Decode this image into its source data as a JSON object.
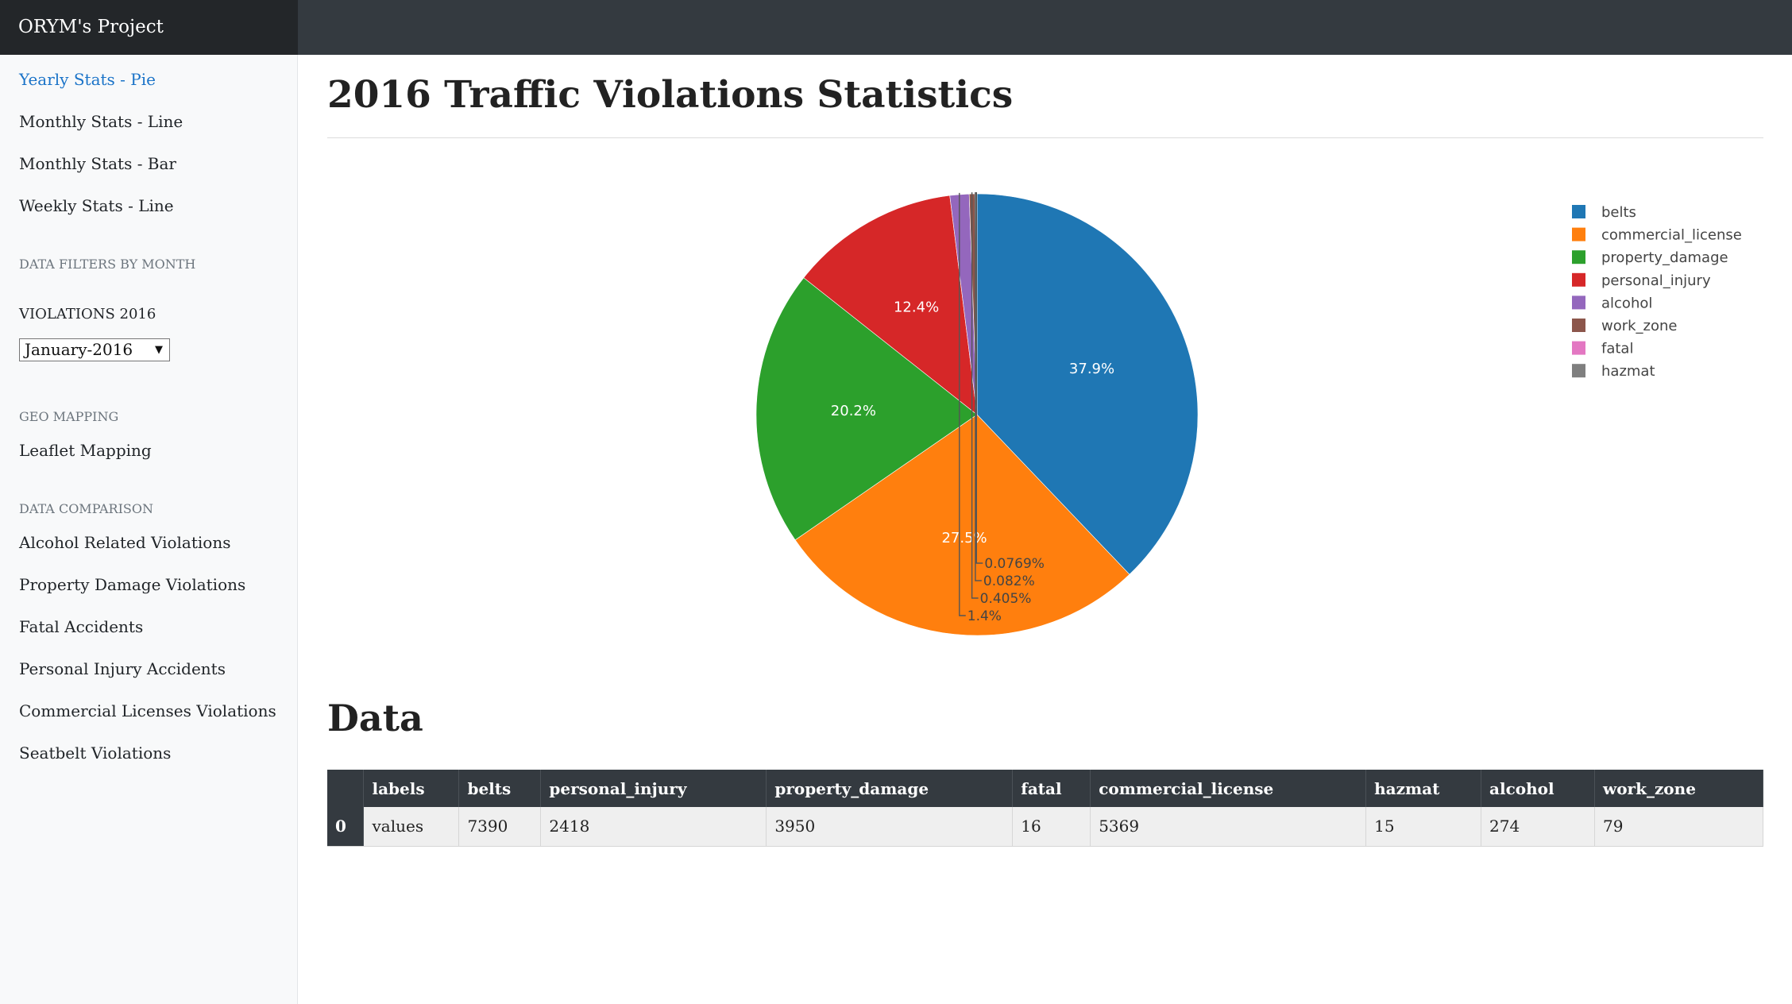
{
  "brand": "ORYM's Project",
  "sidebar": {
    "nav": [
      {
        "label": "Yearly Stats - Pie"
      },
      {
        "label": "Monthly Stats - Line"
      },
      {
        "label": "Monthly Stats - Bar"
      },
      {
        "label": "Weekly Stats - Line"
      }
    ],
    "filters_heading": "DATA FILTERS BY MONTH",
    "violations_label": "VIOLATIONS 2016",
    "month_select": {
      "selected": "January-2016"
    },
    "geo_heading": "GEO MAPPING",
    "geo_links": [
      {
        "label": "Leaflet Mapping"
      }
    ],
    "comparison_heading": "DATA COMPARISON",
    "comparison_links": [
      {
        "label": "Alcohol Related Violations"
      },
      {
        "label": "Property Damage Violations"
      },
      {
        "label": "Fatal Accidents"
      },
      {
        "label": "Personal Injury Accidents"
      },
      {
        "label": "Commercial Licenses Violations"
      },
      {
        "label": "Seatbelt Violations"
      }
    ]
  },
  "main": {
    "title": "2016 Traffic Violations Statistics",
    "data_title": "Data"
  },
  "colors": {
    "belts": "#1f77b4",
    "commercial_license": "#ff7f0e",
    "property_damage": "#2ca02c",
    "personal_injury": "#d62728",
    "alcohol": "#9467bd",
    "work_zone": "#8c564b",
    "fatal": "#e377c2",
    "hazmat": "#7f7f7f"
  },
  "chart_data": {
    "type": "pie",
    "title": "",
    "slices": [
      {
        "label": "belts",
        "value": 7390,
        "pct_label": "37.9%"
      },
      {
        "label": "commercial_license",
        "value": 5369,
        "pct_label": "27.5%"
      },
      {
        "label": "property_damage",
        "value": 3950,
        "pct_label": "20.2%"
      },
      {
        "label": "personal_injury",
        "value": 2418,
        "pct_label": "12.4%"
      },
      {
        "label": "alcohol",
        "value": 274,
        "pct_label": "1.4%"
      },
      {
        "label": "work_zone",
        "value": 79,
        "pct_label": "0.405%"
      },
      {
        "label": "fatal",
        "value": 16,
        "pct_label": "0.082%"
      },
      {
        "label": "hazmat",
        "value": 15,
        "pct_label": "0.0769%"
      }
    ],
    "legend": [
      "belts",
      "commercial_license",
      "property_damage",
      "personal_injury",
      "alcohol",
      "work_zone",
      "fatal",
      "hazmat"
    ],
    "legend_position": "top-right"
  },
  "table": {
    "headers": [
      "",
      "labels",
      "belts",
      "personal_injury",
      "property_damage",
      "fatal",
      "commercial_license",
      "hazmat",
      "alcohol",
      "work_zone"
    ],
    "rows": [
      [
        "0",
        "values",
        "7390",
        "2418",
        "3950",
        "16",
        "5369",
        "15",
        "274",
        "79"
      ]
    ]
  }
}
